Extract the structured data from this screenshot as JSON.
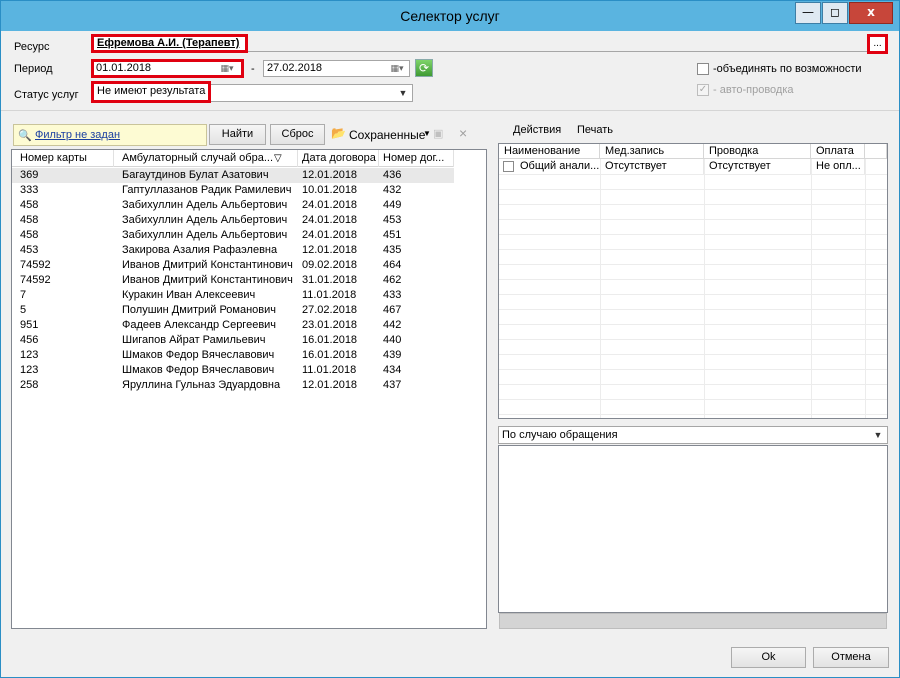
{
  "window": {
    "title": "Селектор услуг",
    "min_glyph": "—",
    "max_glyph": "◻",
    "close_glyph": "x"
  },
  "form": {
    "resource_label": "Ресурс",
    "resource_value": "Ефремова А.И. (Терапевт)",
    "resource_btn": "...",
    "period_label": "Период",
    "period_from": "01.01.2018",
    "period_sep": "-",
    "period_to": "27.02.2018",
    "status_label": "Статус услуг",
    "status_value": "Не имеют результата",
    "combine_label": "-объединять по возможности",
    "auto_label": "- авто-проводка"
  },
  "filter": {
    "link": "Фильтр не задан",
    "find": "Найти",
    "reset": "Сброс",
    "saved": "Сохраненные",
    "clear_glyph": "×"
  },
  "left_grid": {
    "columns": [
      "Номер карты",
      "Амбулаторный случай обра...",
      "Дата договора",
      "Номер дог..."
    ],
    "rows": [
      [
        "369",
        "Багаутдинов Булат Азатович",
        "12.01.2018",
        "436"
      ],
      [
        "333",
        "Гаптуллазанов Радик Рамилевич",
        "10.01.2018",
        "432"
      ],
      [
        "458",
        "Забихуллин Адель Альбертович",
        "24.01.2018",
        "449"
      ],
      [
        "458",
        "Забихуллин Адель Альбертович",
        "24.01.2018",
        "453"
      ],
      [
        "458",
        "Забихуллин Адель Альбертович",
        "24.01.2018",
        "451"
      ],
      [
        "453",
        "Закирова Азалия Рафаэлевна",
        "12.01.2018",
        "435"
      ],
      [
        "74592",
        "Иванов Дмитрий Константинович",
        "09.02.2018",
        "464"
      ],
      [
        "74592",
        "Иванов Дмитрий Константинович",
        "31.01.2018",
        "462"
      ],
      [
        "7",
        "Куракин Иван Алексеевич",
        "11.01.2018",
        "433"
      ],
      [
        "5",
        "Полушин Дмитрий Романович",
        "27.02.2018",
        "467"
      ],
      [
        "951",
        "Фадеев Александр Сергеевич",
        "23.01.2018",
        "442"
      ],
      [
        "456",
        "Шигапов Айрат Рамильевич",
        "16.01.2018",
        "440"
      ],
      [
        "123",
        "Шмаков Федор Вячеславович",
        "16.01.2018",
        "439"
      ],
      [
        "123",
        "Шмаков Федор Вячеславович",
        "11.01.2018",
        "434"
      ],
      [
        "258",
        "Яруллина Гульназ Эдуардовна",
        "12.01.2018",
        "437"
      ]
    ]
  },
  "right_toolbar": {
    "actions": "Действия",
    "print": "Печать"
  },
  "right_grid": {
    "columns": [
      "Наименование",
      "Мед.запись",
      "Проводка",
      "Оплата"
    ],
    "rows": [
      [
        "Общий анали...",
        "Отсутствует",
        "Отсутствует",
        "Не опл..."
      ]
    ]
  },
  "group_select": "По случаю обращения",
  "footer": {
    "ok": "Ok",
    "cancel": "Отмена"
  },
  "colors": {
    "titlebar": "#5ab4e0",
    "highlight": "#e00010",
    "selected_row": "#e8e8e8"
  }
}
